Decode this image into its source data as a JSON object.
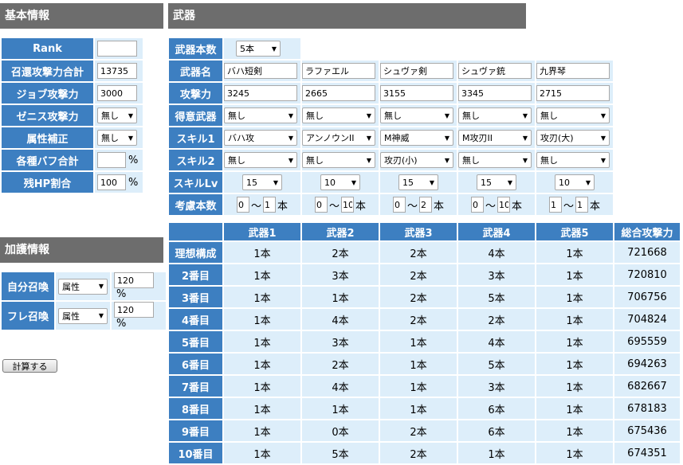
{
  "basic": {
    "header": "基本情報",
    "rank_label": "Rank",
    "rank_value": "",
    "summon_atk_label": "召還攻撃力合計",
    "summon_atk_value": "13735",
    "job_atk_label": "ジョブ攻撃力",
    "job_atk_value": "3000",
    "zenith_label": "ゼニス攻撃力",
    "zenith_value": "無し",
    "element_label": "属性補正",
    "element_value": "無し",
    "buff_label": "各種バフ合計",
    "buff_value": "",
    "buff_unit": "%",
    "hp_label": "残HP割合",
    "hp_value": "100",
    "hp_unit": "%"
  },
  "blessing": {
    "header": "加護情報",
    "self_label": "自分召喚",
    "self_type": "属性",
    "self_value": "120",
    "self_unit": "%",
    "friend_label": "フレ召喚",
    "friend_type": "属性",
    "friend_value": "120",
    "friend_unit": "%"
  },
  "calc_button": "計算する",
  "weapons": {
    "header": "武器",
    "count_label": "武器本数",
    "count_value": "5本",
    "name_label": "武器名",
    "atk_label": "攻撃力",
    "fav_label": "得意武器",
    "skill1_label": "スキル1",
    "skill2_label": "スキル2",
    "skilllv_label": "スキルLv",
    "consider_label": "考慮本数",
    "tilde": "〜",
    "hon": "本",
    "list": [
      {
        "name": "バハ短剣",
        "atk": "3245",
        "fav": "無し",
        "skill1": "バハ攻",
        "skill2": "無し",
        "lv": "15",
        "min": "0",
        "max": "1"
      },
      {
        "name": "ラファエル",
        "atk": "2665",
        "fav": "無し",
        "skill1": "アンノウンII",
        "skill2": "無し",
        "lv": "10",
        "min": "0",
        "max": "10"
      },
      {
        "name": "シュヴァ剣",
        "atk": "3155",
        "fav": "無し",
        "skill1": "M神威",
        "skill2": "攻刃(小)",
        "lv": "15",
        "min": "0",
        "max": "2"
      },
      {
        "name": "シュヴァ銃",
        "atk": "3345",
        "fav": "無し",
        "skill1": "M攻刃II",
        "skill2": "無し",
        "lv": "15",
        "min": "0",
        "max": "10"
      },
      {
        "name": "九界琴",
        "atk": "2715",
        "fav": "無し",
        "skill1": "攻刃(大)",
        "skill2": "無し",
        "lv": "10",
        "min": "1",
        "max": "1"
      }
    ]
  },
  "results": {
    "headers": [
      "武器1",
      "武器2",
      "武器3",
      "武器4",
      "武器5",
      "総合攻撃力"
    ],
    "rows": [
      {
        "label": "理想構成",
        "cells": [
          "1本",
          "2本",
          "2本",
          "4本",
          "1本"
        ],
        "total": "721668"
      },
      {
        "label": "2番目",
        "cells": [
          "1本",
          "3本",
          "2本",
          "3本",
          "1本"
        ],
        "total": "720810"
      },
      {
        "label": "3番目",
        "cells": [
          "1本",
          "1本",
          "2本",
          "5本",
          "1本"
        ],
        "total": "706756"
      },
      {
        "label": "4番目",
        "cells": [
          "1本",
          "4本",
          "2本",
          "2本",
          "1本"
        ],
        "total": "704824"
      },
      {
        "label": "5番目",
        "cells": [
          "1本",
          "3本",
          "1本",
          "4本",
          "1本"
        ],
        "total": "695559"
      },
      {
        "label": "6番目",
        "cells": [
          "1本",
          "2本",
          "1本",
          "5本",
          "1本"
        ],
        "total": "694263"
      },
      {
        "label": "7番目",
        "cells": [
          "1本",
          "4本",
          "1本",
          "3本",
          "1本"
        ],
        "total": "682667"
      },
      {
        "label": "8番目",
        "cells": [
          "1本",
          "1本",
          "1本",
          "6本",
          "1本"
        ],
        "total": "678183"
      },
      {
        "label": "9番目",
        "cells": [
          "1本",
          "0本",
          "2本",
          "6本",
          "1本"
        ],
        "total": "675436"
      },
      {
        "label": "10番目",
        "cells": [
          "1本",
          "5本",
          "2本",
          "1本",
          "1本"
        ],
        "total": "674351"
      }
    ]
  }
}
